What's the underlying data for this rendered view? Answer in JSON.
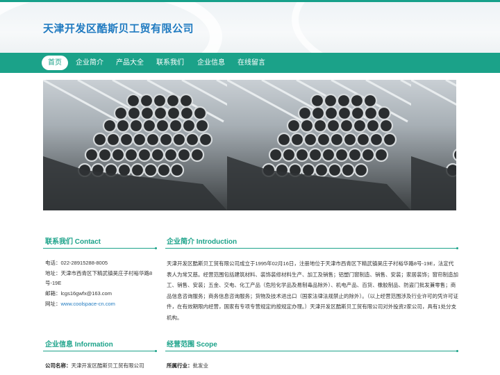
{
  "site": {
    "title": "天津开发区酷斯贝工贸有限公司"
  },
  "nav": {
    "items": [
      {
        "label": "首页",
        "active": true
      },
      {
        "label": "企业简介",
        "active": false
      },
      {
        "label": "产品大全",
        "active": false
      },
      {
        "label": "联系我们",
        "active": false
      },
      {
        "label": "企业信息",
        "active": false
      },
      {
        "label": "在线留言",
        "active": false
      }
    ]
  },
  "banner": {
    "image": "steel-pipes-photo"
  },
  "contact": {
    "title": "联系我们 Contact",
    "phone": "电话：022-28915288-8005",
    "address_line1": "地址：天津市西青区下精武镇昊庄子村裕华路8",
    "address_line2": "号-19E",
    "email": "邮箱：lcgs16gwfx@163.com",
    "website_label": "网址：",
    "website": "www.coolspace-cn.com"
  },
  "intro": {
    "title": "企业简介 Introduction",
    "text": "天津开发区酷斯贝工贸有限公司成立于1995年02月16日，注册地位于天津市西青区下精武镇昊庄子村裕华路8号-19E，法定代表人为常又慈。经营范围包括建筑材料、装饰装修材料生产、加工及销售；铝塑门窗制造、销售、安装；家居装饰；窗帘制造加工、销售、安装；五金、交电、化工产品（危险化学品及易制毒品除外）、机电产品、百货、橡胶制品、防盗门批发兼零售；商品信息咨询服务；商务信息咨询服务；货物及技术进出口（国家法律法规禁止的除外）。（以上经营范围涉及行业许可的凭许可证件，在有效期限内经营，国家有专项专营规定的按规定办理。）天津开发区酷斯贝工贸有限公司对外投资2家公司，具有1处分支机构。"
  },
  "company_info": {
    "title": "企业信息 Information",
    "name_label": "公司名称：",
    "name_value": "天津开发区酷斯贝工贸有限公司"
  },
  "scope": {
    "title": "经营范围 Scope",
    "industry_label": "所属行业：",
    "industry_value": "批发业"
  }
}
